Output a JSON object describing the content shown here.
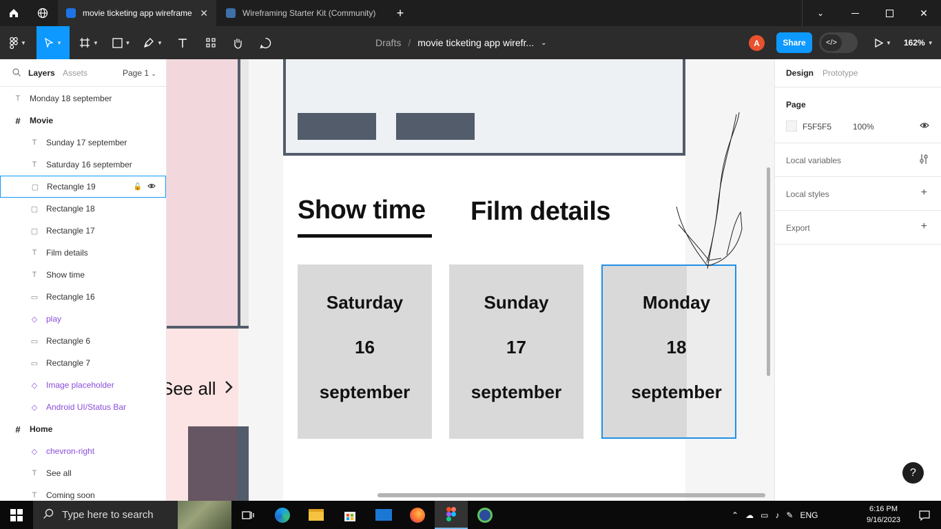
{
  "tabs": [
    {
      "label": "movie ticketing app wireframe",
      "active": true
    },
    {
      "label": "Wireframing Starter Kit (Community)",
      "active": false
    }
  ],
  "breadcrumb": {
    "parent": "Drafts",
    "separator": "/",
    "file": "movie ticketing app wirefr..."
  },
  "toolbar": {
    "avatar": "A",
    "share_label": "Share",
    "devmode_label": "</>",
    "zoom": "162%"
  },
  "left_panel": {
    "tabs": [
      "Layers",
      "Assets"
    ],
    "page_selector": "Page 1",
    "layers": [
      {
        "label": "Monday 18 september",
        "type": "text",
        "indent": 0
      },
      {
        "label": "Movie",
        "type": "frame",
        "indent": 0
      },
      {
        "label": "Sunday 17 september",
        "type": "text",
        "indent": 1
      },
      {
        "label": "Saturday 16 september",
        "type": "text",
        "indent": 1
      },
      {
        "label": "Rectangle 19",
        "type": "rect",
        "indent": 1,
        "selected": true
      },
      {
        "label": "Rectangle 18",
        "type": "rect",
        "indent": 1
      },
      {
        "label": "Rectangle 17",
        "type": "rect",
        "indent": 1
      },
      {
        "label": "Film details",
        "type": "text",
        "indent": 1
      },
      {
        "label": "Show time",
        "type": "text",
        "indent": 1
      },
      {
        "label": "Rectangle 16",
        "type": "line",
        "indent": 1
      },
      {
        "label": "play",
        "type": "component",
        "indent": 1
      },
      {
        "label": "Rectangle 6",
        "type": "line",
        "indent": 1
      },
      {
        "label": "Rectangle 7",
        "type": "line",
        "indent": 1
      },
      {
        "label": "Image placeholder",
        "type": "component",
        "indent": 1
      },
      {
        "label": "Android UI/Status Bar",
        "type": "component",
        "indent": 1
      },
      {
        "label": "Home",
        "type": "frame",
        "indent": 0
      },
      {
        "label": "chevron-right",
        "type": "component",
        "indent": 1
      },
      {
        "label": "See all",
        "type": "text",
        "indent": 1
      },
      {
        "label": "Coming soon",
        "type": "text",
        "indent": 1
      }
    ]
  },
  "right_panel": {
    "tabs": [
      "Design",
      "Prototype"
    ],
    "page_section": {
      "title": "Page",
      "color": "F5F5F5",
      "opacity": "100%"
    },
    "sections": [
      "Local variables",
      "Local styles",
      "Export"
    ]
  },
  "canvas": {
    "see_all": "See all",
    "show_time": "Show time",
    "film_details": "Film details",
    "dates": [
      {
        "day": "Saturday",
        "num": "16",
        "month": "september"
      },
      {
        "day": "Sunday",
        "num": "17",
        "month": "september"
      },
      {
        "day": "Monday",
        "num": "18",
        "month": "september"
      }
    ]
  },
  "taskbar": {
    "search_placeholder": "Type here to search",
    "lang": "ENG",
    "time": "6:16 PM",
    "date": "9/16/2023"
  },
  "colors": {
    "accent": "#0d99ff",
    "wire_dark": "#535c6b",
    "card": "#d9d9d9"
  }
}
